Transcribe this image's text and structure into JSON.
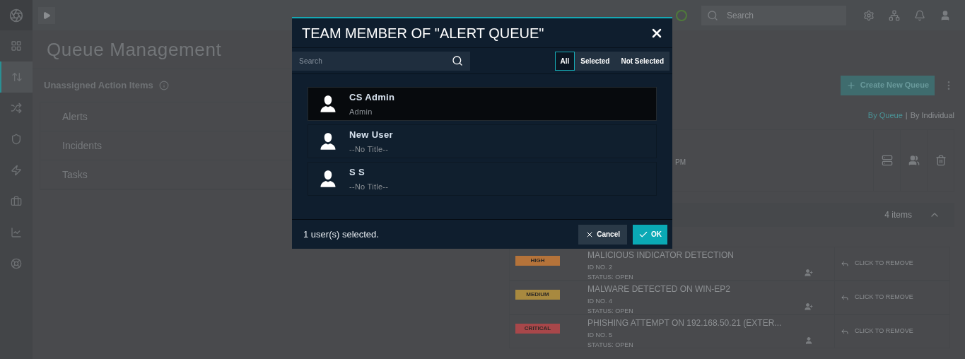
{
  "topbar": {
    "search_placeholder": "Search"
  },
  "sidebar": {
    "items": [
      {
        "kind": "dashboard",
        "selected": false
      },
      {
        "kind": "queue",
        "selected": true
      },
      {
        "kind": "shuffle",
        "selected": false
      },
      {
        "kind": "shield",
        "selected": false
      },
      {
        "kind": "bolt",
        "selected": false
      },
      {
        "kind": "briefcase",
        "selected": false
      },
      {
        "kind": "chart",
        "selected": false
      },
      {
        "kind": "lifebuoy",
        "selected": false
      }
    ]
  },
  "page": {
    "title": "Queue Management"
  },
  "unassigned": {
    "title": "Unassigned Action Items",
    "items": [
      "Alerts",
      "Incidents",
      "Tasks"
    ]
  },
  "queues": {
    "create_button": "Create New Queue",
    "view_toggle": [
      {
        "label": "By Queue",
        "selected": true
      },
      {
        "label": "By Individual",
        "selected": false
      }
    ],
    "toggle_separator": "|",
    "queue_row": {
      "time_fragment": "PM"
    },
    "items_count": "4 items",
    "items": [
      {
        "severity": "HIGH",
        "color": "#b5733a",
        "title": "MALICIOUS INDICATOR DETECTION",
        "id": "ID NO. 2",
        "status_label": "STATUS:",
        "status": "OPEN",
        "kind": "unassigned",
        "action": "CLICK TO REMOVE"
      },
      {
        "severity": "MEDIUM",
        "color": "#a8893f",
        "title": "MALWARE DETECTED ON WIN-EP2",
        "id": "ID NO. 4",
        "status_label": "STATUS:",
        "status": "OPEN",
        "kind": "unassigned",
        "action": "CLICK TO REMOVE"
      },
      {
        "severity": "CRITICAL",
        "color": "#a8474a",
        "title": "PHISHING ATTEMPT ON 192.168.50.21 (EXTER...",
        "id": "ID NO. 5",
        "status_label": "STATUS:",
        "status": "OPEN",
        "kind": "assigned",
        "action": "CLICK TO REMOVE"
      }
    ]
  },
  "modal": {
    "title": "TEAM MEMBER OF \"ALERT QUEUE\"",
    "search_placeholder": "Search",
    "filters": [
      {
        "label": "All",
        "selected": true
      },
      {
        "label": "Selected",
        "selected": false
      },
      {
        "label": "Not Selected",
        "selected": false
      }
    ],
    "users": [
      {
        "name": "CS Admin",
        "title": "Admin",
        "selected": true
      },
      {
        "name": "New User",
        "title": "--No Title--",
        "selected": false
      },
      {
        "name": "S S",
        "title": "--No Title--",
        "selected": false
      }
    ],
    "status": "1 user(s) selected.",
    "cancel": "Cancel",
    "ok": "OK"
  }
}
